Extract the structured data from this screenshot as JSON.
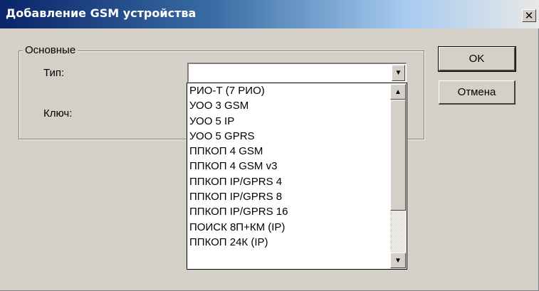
{
  "window": {
    "title": "Добавление GSM устройства",
    "close_glyph": "✕"
  },
  "group": {
    "legend": "Основные",
    "type_label": "Тип:",
    "key_label": "Ключ:",
    "type_value": ""
  },
  "buttons": {
    "ok": "OK",
    "cancel": "Отмена"
  },
  "dropdown": {
    "items": [
      "РИО-Т (7 РИО)",
      "УОО 3 GSM",
      "УОО 5 IP",
      "УОО 5 GPRS",
      "ППКОП 4 GSM",
      "ППКОП 4 GSM v3",
      "ППКОП IP/GPRS 4",
      "ППКОП IP/GPRS 8",
      "ППКОП IP/GPRS 16",
      "ПОИСК 8П+КМ (IP)",
      "ППКОП 24К (IP)"
    ],
    "scroll_up_icon": "triangle-up",
    "scroll_down_icon": "triangle-down"
  }
}
